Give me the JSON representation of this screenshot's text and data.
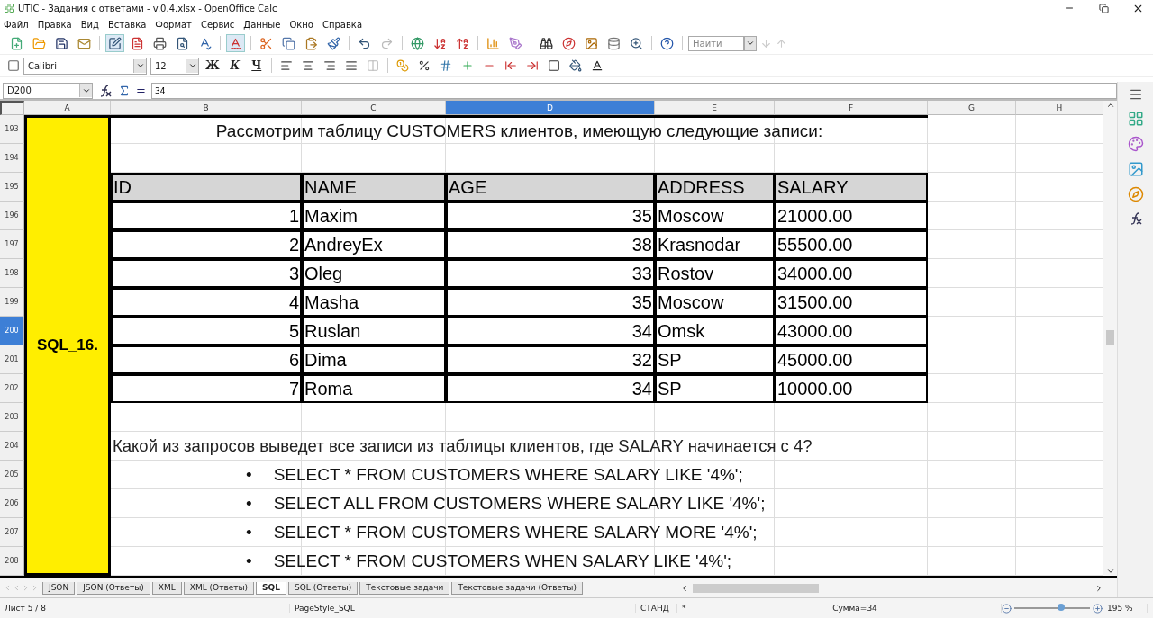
{
  "window": {
    "title": "UTIC - Задания с ответами - v.0.4.xlsx - OpenOffice Calc"
  },
  "menu": [
    "Файл",
    "Правка",
    "Вид",
    "Вставка",
    "Формат",
    "Сервис",
    "Данные",
    "Окно",
    "Справка"
  ],
  "find": {
    "placeholder": "Найти"
  },
  "font": {
    "name": "Calibri",
    "size": "12"
  },
  "format_buttons": [
    "Ж",
    "К",
    "Ч"
  ],
  "formula_bar": {
    "cell_ref": "D200",
    "equals": "=",
    "value": "34"
  },
  "columns": [
    {
      "label": "A",
      "selected": false
    },
    {
      "label": "B",
      "selected": false
    },
    {
      "label": "C",
      "selected": false
    },
    {
      "label": "D",
      "selected": true
    },
    {
      "label": "E",
      "selected": false
    },
    {
      "label": "F",
      "selected": false
    },
    {
      "label": "G",
      "selected": false
    },
    {
      "label": "H",
      "selected": false
    }
  ],
  "rows": [
    {
      "label": "193",
      "selected": false
    },
    {
      "label": "194",
      "selected": false
    },
    {
      "label": "195",
      "selected": false
    },
    {
      "label": "196",
      "selected": false
    },
    {
      "label": "197",
      "selected": false
    },
    {
      "label": "198",
      "selected": false
    },
    {
      "label": "199",
      "selected": false
    },
    {
      "label": "200",
      "selected": true
    },
    {
      "label": "201",
      "selected": false
    },
    {
      "label": "202",
      "selected": false
    },
    {
      "label": "203",
      "selected": false
    },
    {
      "label": "204",
      "selected": false
    },
    {
      "label": "205",
      "selected": false
    },
    {
      "label": "206",
      "selected": false
    },
    {
      "label": "207",
      "selected": false
    },
    {
      "label": "208",
      "selected": false
    }
  ],
  "task_label": "SQL_16.",
  "intro": "Рассмотрим таблицу CUSTOMERS клиентов, имеющую следующие записи:",
  "table": {
    "columns": [
      "ID",
      "NAME",
      "AGE",
      "ADDRESS",
      "SALARY"
    ],
    "rows": [
      [
        "1",
        "Maxim",
        "35",
        "Moscow",
        "21000.00"
      ],
      [
        "2",
        "AndreyEx",
        "38",
        "Krasnodar",
        "55500.00"
      ],
      [
        "3",
        "Oleg",
        "33",
        "Rostov",
        "34000.00"
      ],
      [
        "4",
        "Masha",
        "35",
        "Moscow",
        "31500.00"
      ],
      [
        "5",
        "Ruslan",
        "34",
        "Omsk",
        "43000.00"
      ],
      [
        "6",
        "Dima",
        "32",
        "SP",
        "45000.00"
      ],
      [
        "7",
        "Roma",
        "34",
        "SP",
        "10000.00"
      ]
    ]
  },
  "question": "Какой из запросов выведет все записи из таблицы клиентов, где SALARY начинается с 4?",
  "options": [
    {
      "bullet": "•",
      "text": "SELECT * FROM CUSTOMERS WHERE SALARY LIKE '4%';"
    },
    {
      "bullet": "•",
      "text": "SELECT ALL FROM CUSTOMERS WHERE SALARY LIKE '4%';"
    },
    {
      "bullet": "•",
      "text": "SELECT * FROM CUSTOMERS WHERE SALARY MORE '4%';"
    },
    {
      "bullet": "•",
      "text": "SELECT * FROM CUSTOMERS WHEN SALARY LIKE '4%';"
    }
  ],
  "sheet_tabs": [
    {
      "label": "JSON",
      "selected": false
    },
    {
      "label": "JSON (Ответы)",
      "selected": false
    },
    {
      "label": "XML",
      "selected": false
    },
    {
      "label": "XML (Ответы)",
      "selected": false
    },
    {
      "label": "SQL",
      "selected": true
    },
    {
      "label": "SQL (Ответы)",
      "selected": false
    },
    {
      "label": "Текстовые задачи",
      "selected": false
    },
    {
      "label": "Текстовые задачи (Ответы)",
      "selected": false
    }
  ],
  "status_bar": {
    "sheet": "Лист 5 / 8",
    "page_style": "PageStyle_SQL",
    "mode": "СТАНД",
    "modified": "*",
    "sum": "Сумма=34",
    "zoom": "195 %"
  },
  "zoom_slider": {
    "level": 0.62
  }
}
